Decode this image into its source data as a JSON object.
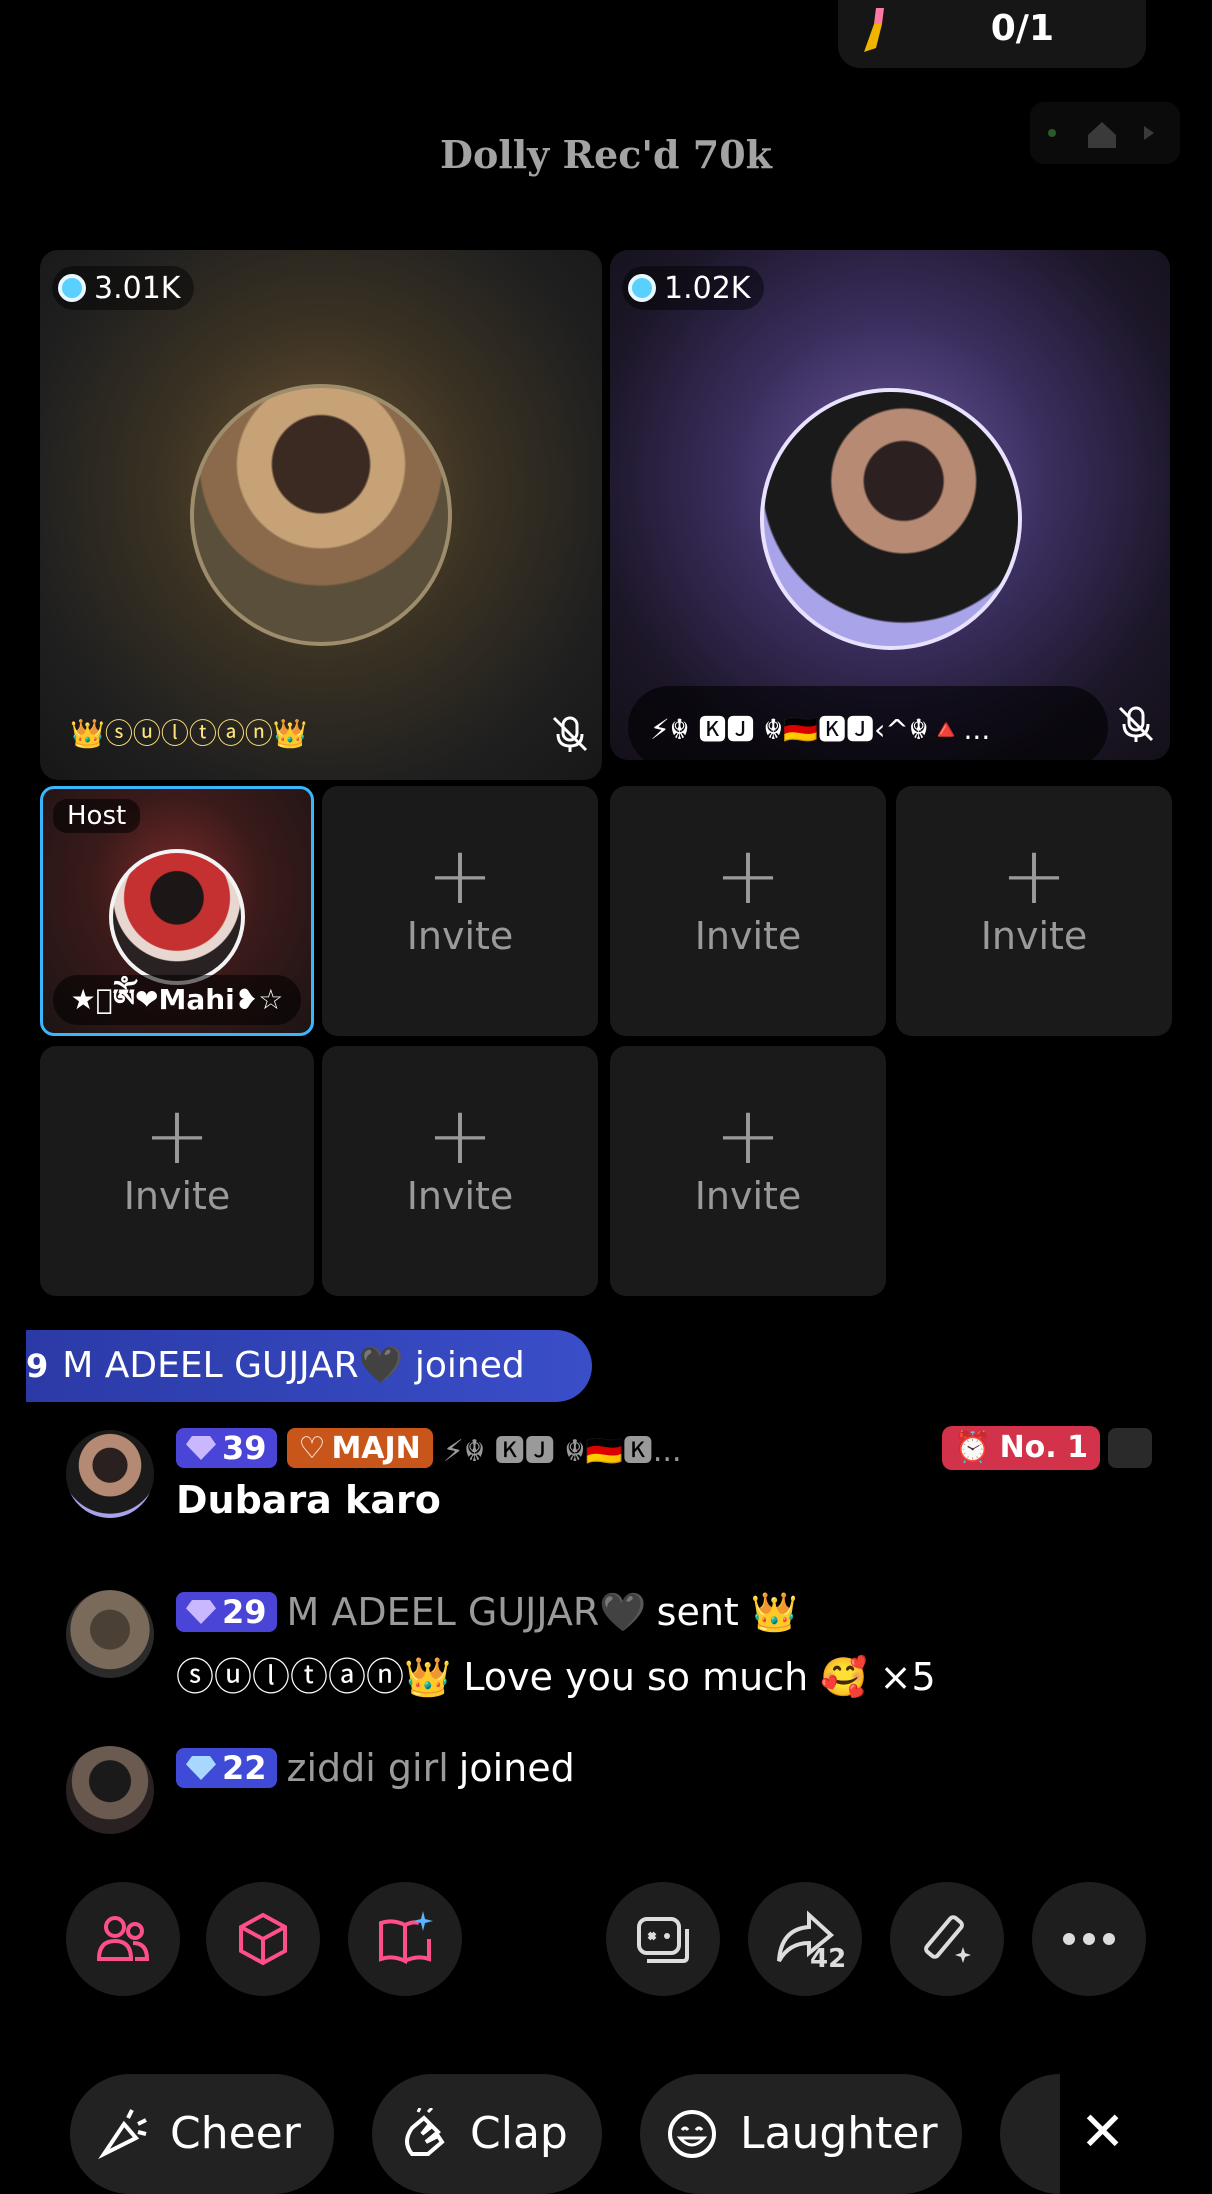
{
  "top": {
    "counter": "0/1"
  },
  "banner": {
    "text": "Dolly Rec'd 70k"
  },
  "seats": {
    "seat1": {
      "coins": "3.01K",
      "name": "👑ⓢⓤⓛⓣⓐⓝ👑"
    },
    "seat2": {
      "coins": "1.02K",
      "name": "⚡☬ 🅺🅹 ☬🇩🇪🅺🅹‹^☬🔺..."
    },
    "host": {
      "tag": "Host",
      "name": "★ིༀ❤Mahi❥☆"
    },
    "invite": {
      "plus": "+",
      "label": "Invite"
    }
  },
  "join_banner": {
    "level": "9",
    "text": "M ADEEL GUJJAR🖤 joined"
  },
  "chat": [
    {
      "level": "39",
      "fan_badge": "MAJN",
      "name": "⚡☬ 🅺🅹 ☬🇩🇪🅺...",
      "rank": "No. 1",
      "message": "Dubara karo"
    },
    {
      "level": "29",
      "name": "M ADEEL GUJJAR🖤",
      "action": "sent 👑",
      "message": "ⓢⓤⓛⓣⓐⓝ👑 Love you so much 🥰 ×5"
    },
    {
      "level": "22",
      "name": "ziddi girl",
      "action": "joined"
    }
  ],
  "toolbar": {
    "share_count": "42"
  },
  "reactions": {
    "cheer": "Cheer",
    "clap": "Clap",
    "laughter": "Laughter"
  },
  "icons": [
    "gift-pull-icon",
    "home-icon",
    "coin-icon",
    "mic-off-icon",
    "gem-icon",
    "users-icon",
    "cube-icon",
    "book-sparkle-icon",
    "game-controller-icon",
    "share-icon",
    "magic-wand-icon",
    "more-icon",
    "cheer-icon",
    "clap-icon",
    "laughter-icon",
    "close-icon"
  ],
  "colors": {
    "accent_pink": "#ff4f8b",
    "level_badge": "#4a45d6",
    "host_border": "#3ab6ff",
    "join_banner": "#3a4ec9",
    "rank_badge": "#d2334a"
  }
}
